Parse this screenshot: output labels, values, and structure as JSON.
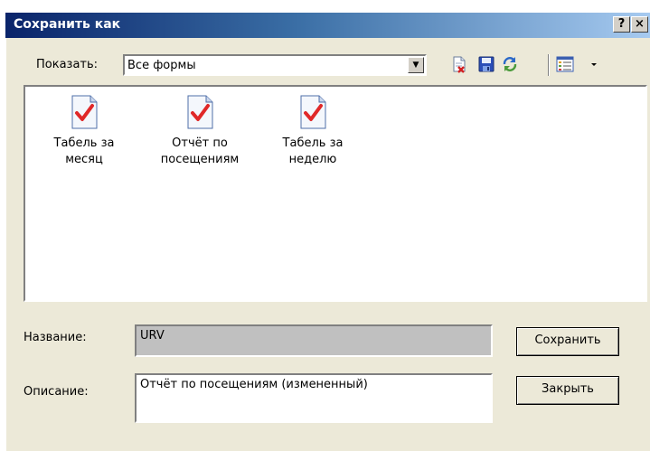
{
  "window": {
    "title": "Сохранить как",
    "help_label": "?",
    "close_label": "×"
  },
  "toolbar": {
    "show_label": "Показать:",
    "filter_value": "Все формы",
    "icons": [
      "delete-icon",
      "save-icon",
      "refresh-icon",
      "view-icon"
    ]
  },
  "forms": [
    {
      "label": "Табель за\nмесяц",
      "icon": "form-document-icon"
    },
    {
      "label": "Отчёт по\nпосещениям",
      "icon": "form-document-icon"
    },
    {
      "label": "Табель за\nнеделю",
      "icon": "form-document-icon"
    }
  ],
  "name_label": "Название:",
  "name_value": "URV",
  "description_label": "Описание:",
  "description_value": "Отчёт по посещениям (измененный)",
  "buttons": {
    "save": "Сохранить",
    "close": "Закрыть"
  }
}
